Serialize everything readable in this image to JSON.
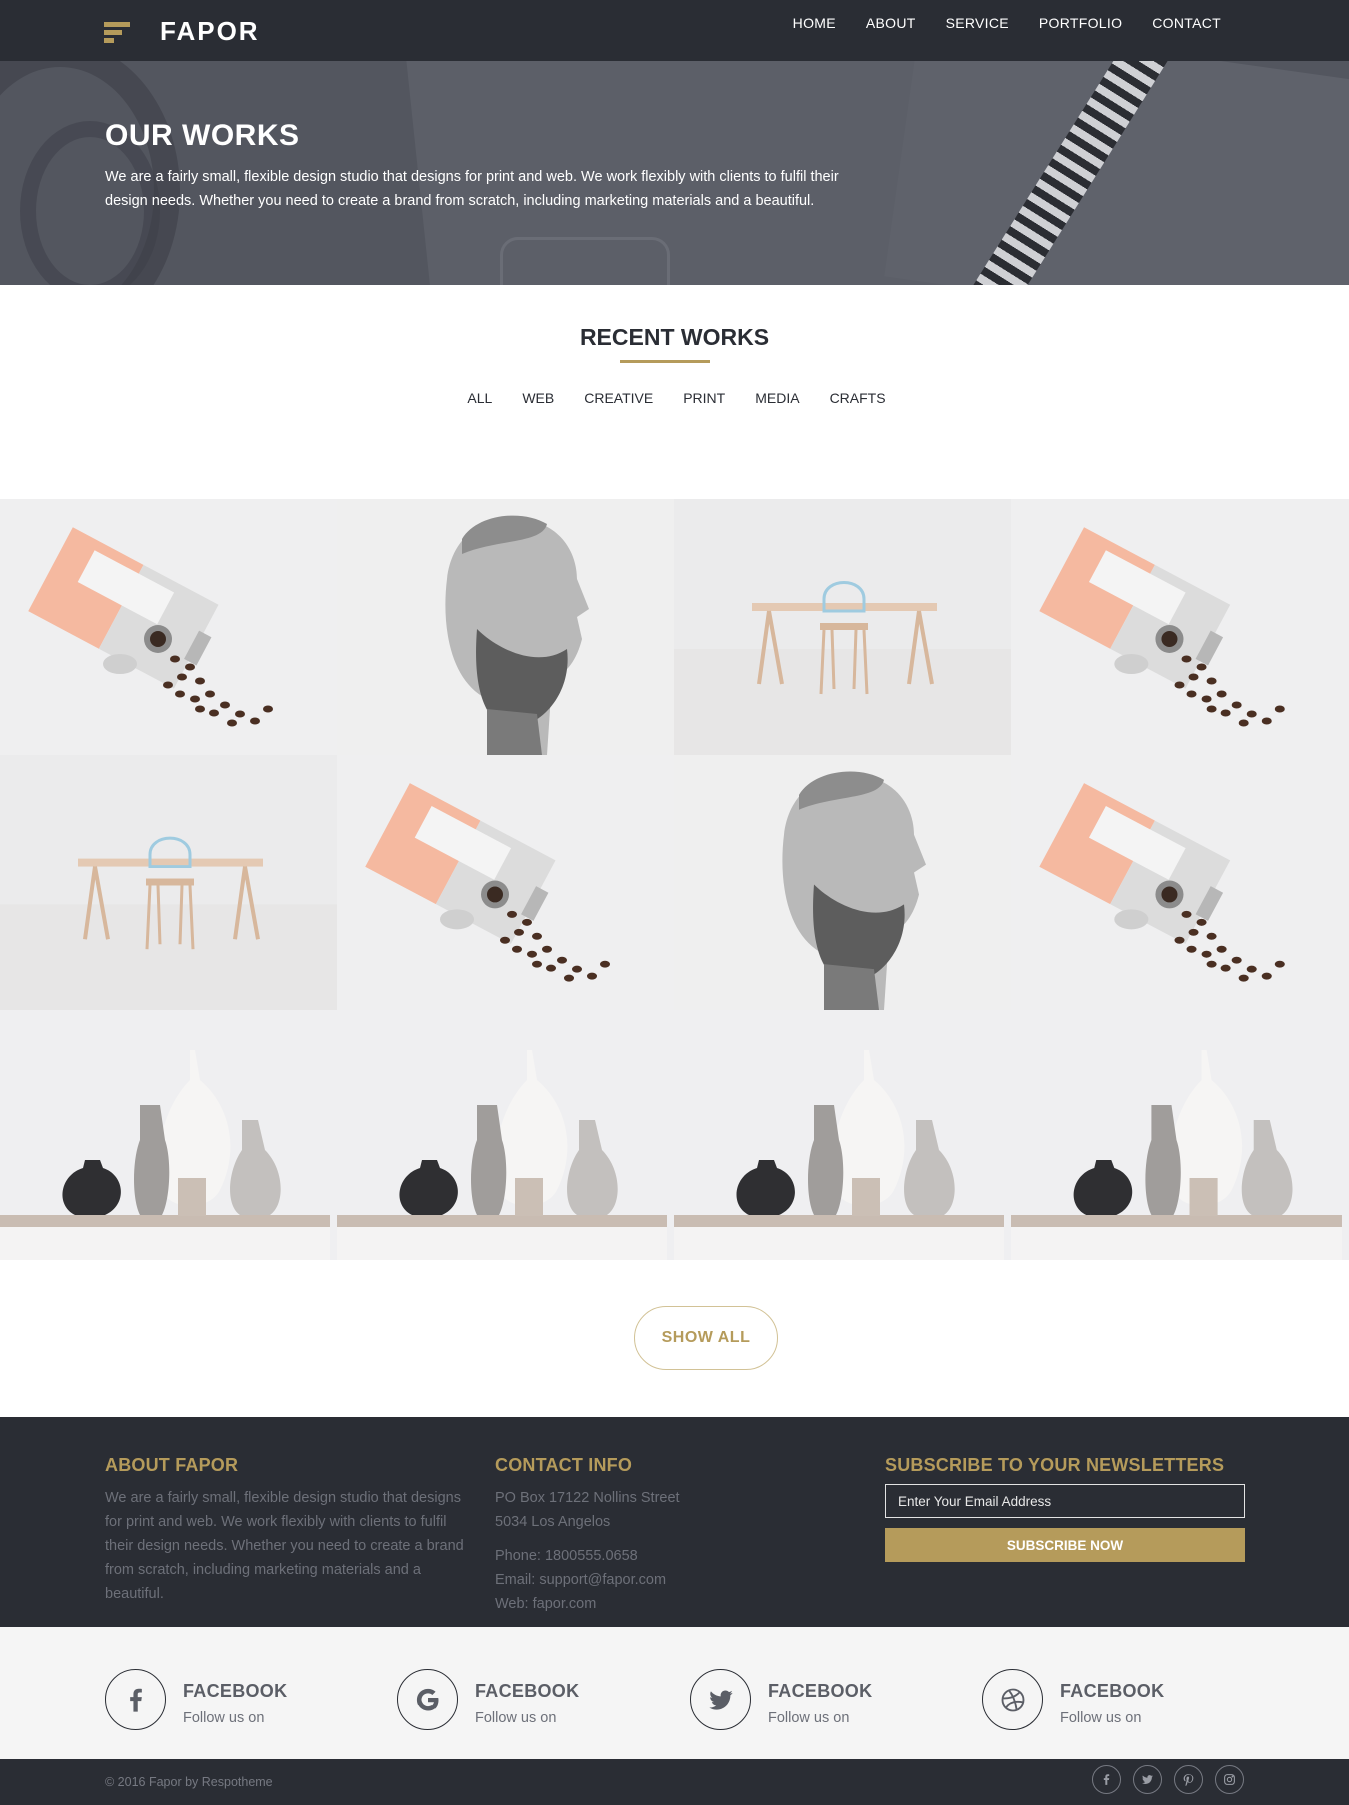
{
  "brand": {
    "name": "FAPOR",
    "accent_color": "#b59b5b",
    "dark_color": "#2a2d34"
  },
  "nav": {
    "items": [
      "HOME",
      "ABOUT",
      "SERVICE",
      "PORTFOLIO",
      "CONTACT"
    ]
  },
  "hero": {
    "title": "OUR WORKS",
    "text": "We are a fairly small, flexible design studio that designs for print and web. We work flexibly with clients to fulfil their design needs. Whether you need to create a brand from scratch, including marketing materials and a beautiful."
  },
  "recent": {
    "title": "RECENT WORKS",
    "filters": [
      "ALL",
      "WEB",
      "CREATIVE",
      "PRINT",
      "MEDIA",
      "CRAFTS"
    ],
    "tiles": [
      "coffee-tin",
      "beard-portrait",
      "table-chair",
      "coffee-tin",
      "table-chair",
      "coffee-tin",
      "beard-portrait",
      "coffee-tin",
      "vases",
      "vases",
      "vases",
      "vases"
    ],
    "show_all": "SHOW ALL"
  },
  "footer": {
    "about": {
      "title": "ABOUT FAPOR",
      "text": "We are a fairly small, flexible design studio that designs for print and web. We work flexibly with clients to fulfil their design needs. Whether you need to create a brand from scratch, including marketing materials and a beautiful."
    },
    "contact": {
      "title": "CONTACT INFO",
      "address1": "PO Box 17122 Nollins Street",
      "address2": "5034 Los Angelos",
      "phone": "Phone: 1800555.0658",
      "email": "Email: support@fapor.com",
      "web": "Web: fapor.com"
    },
    "newsletter": {
      "title": "SUBSCRIBE TO YOUR NEWSLETTERS",
      "placeholder": "Enter Your Email Address",
      "button": "SUBSCRIBE NOW"
    }
  },
  "social": [
    {
      "icon": "facebook-icon",
      "title": "FACEBOOK",
      "sub": "Follow us on"
    },
    {
      "icon": "google-icon",
      "title": "FACEBOOK",
      "sub": "Follow us on"
    },
    {
      "icon": "twitter-icon",
      "title": "FACEBOOK",
      "sub": "Follow us on"
    },
    {
      "icon": "dribbble-icon",
      "title": "FACEBOOK",
      "sub": "Follow us on"
    }
  ],
  "copyright": "© 2016 Fapor by Respotheme",
  "copyright_icons": [
    "facebook-icon",
    "twitter-icon",
    "pinterest-icon",
    "instagram-icon"
  ]
}
